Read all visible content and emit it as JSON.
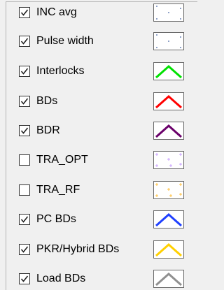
{
  "legend": {
    "items": [
      {
        "label": "INC avg",
        "checked": true,
        "icon": "dotted-marker-icon",
        "color": "#4060a0"
      },
      {
        "label": "Pulse width",
        "checked": true,
        "icon": "dotted-marker-icon",
        "color": "#4060a0"
      },
      {
        "label": "Interlocks",
        "checked": true,
        "icon": "line-peak-icon",
        "color": "#00e000"
      },
      {
        "label": "BDs",
        "checked": true,
        "icon": "line-peak-icon",
        "color": "#ff0000"
      },
      {
        "label": "BDR",
        "checked": true,
        "icon": "line-peak-icon",
        "color": "#6a006a"
      },
      {
        "label": "TRA_OPT",
        "checked": false,
        "icon": "plus-marker-icon",
        "color": "#c8a0ff"
      },
      {
        "label": "TRA_RF",
        "checked": false,
        "icon": "plus-marker-icon",
        "color": "#ffc040"
      },
      {
        "label": "PC BDs",
        "checked": true,
        "icon": "line-peak-icon",
        "color": "#2040ff"
      },
      {
        "label": "PKR/Hybrid BDs",
        "checked": true,
        "icon": "line-peak-icon",
        "color": "#ffd000"
      },
      {
        "label": "Load BDs",
        "checked": true,
        "icon": "line-peak-icon",
        "color": "#909090"
      }
    ]
  }
}
